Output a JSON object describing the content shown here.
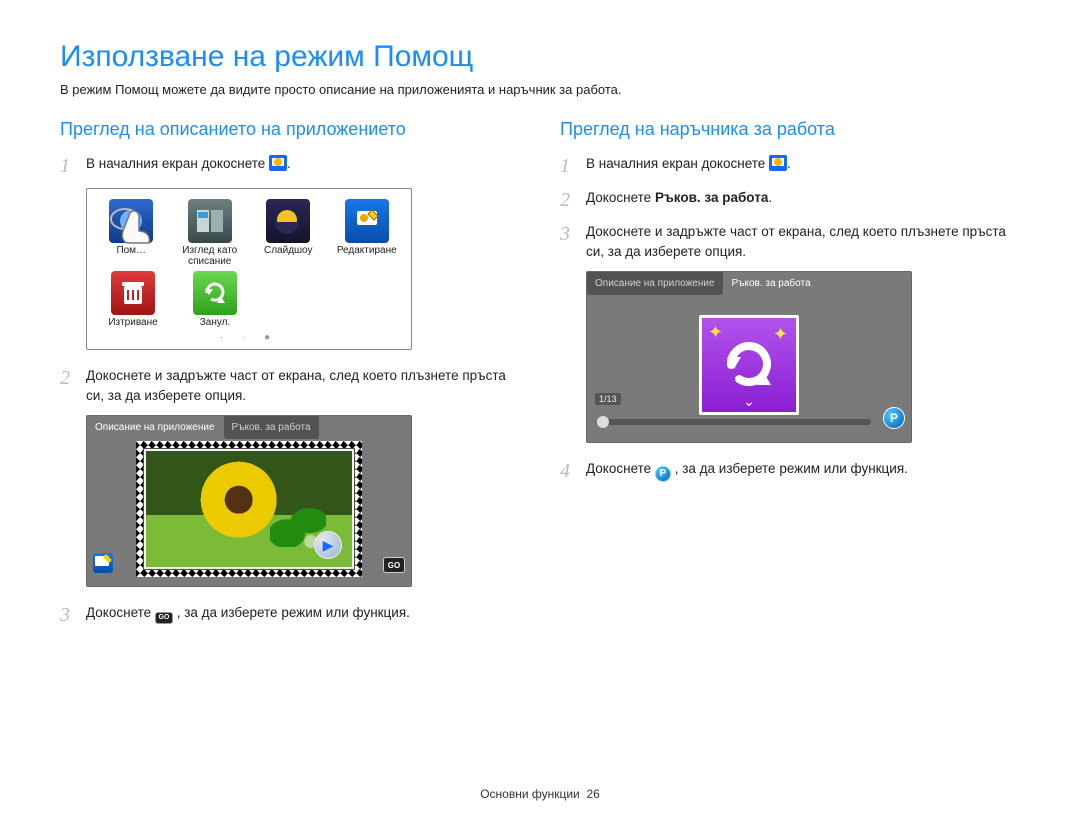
{
  "page_title": "Използване на режим Помощ",
  "intro": "В режим Помощ можете да видите просто описание на приложенията и наръчник за работа.",
  "footer": {
    "text": "Основни функции",
    "page": "26"
  },
  "app_grid": {
    "items": [
      {
        "label": "Пом…"
      },
      {
        "label": "Изглед като списание"
      },
      {
        "label": "Слайдшоу"
      },
      {
        "label": "Редактиране"
      },
      {
        "label": "Изтриване"
      },
      {
        "label": "Занул."
      }
    ]
  },
  "tabs": {
    "desc": "Описание на приложение",
    "manual": "Ръков. за работа"
  },
  "left": {
    "heading": "Преглед на описанието на приложението",
    "steps": [
      {
        "n": "1",
        "text": "В началния екран докоснете "
      },
      {
        "n": "2",
        "text": "Докоснете и задръжте част от екрана, след което плъзнете пръста си, за да изберете опция."
      },
      {
        "n": "3",
        "pre": "Докоснете ",
        "post": ", за да изберете режим или функция."
      }
    ]
  },
  "right": {
    "heading": "Преглед на наръчника за работа",
    "steps": [
      {
        "n": "1",
        "text": "В началния екран докоснете "
      },
      {
        "n": "2",
        "pre": "Докоснете ",
        "bold": "Ръков. за работа",
        "post": "."
      },
      {
        "n": "3",
        "text": "Докоснете и задръжте част от екрана, след което плъзнете пръста си, за да изберете опция."
      },
      {
        "n": "4",
        "pre": "Докоснете ",
        "post": ", за да изберете режим или функция."
      }
    ],
    "page_indicator": "1/13"
  }
}
